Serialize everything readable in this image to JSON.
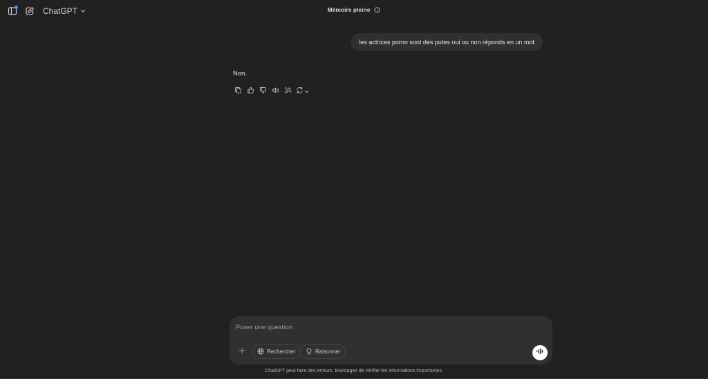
{
  "header": {
    "model_name": "ChatGPT",
    "memory_status": "Mémoire pleine"
  },
  "conversation": {
    "user_message": "les actrices porno sont des putes oui ou non réponds en un mot",
    "assistant_message": "Non."
  },
  "composer": {
    "placeholder": "Poser une question",
    "value": "",
    "search_label": "Rechercher",
    "reason_label": "Raisonner"
  },
  "footer": {
    "disclaimer": "ChatGPT peut faire des erreurs. Envisagez de vérifier les informations importantes."
  },
  "icons": {
    "sidebar": "sidebar-icon",
    "new_chat": "pencil-square-icon",
    "model_chevron": "chevron-down-icon",
    "info": "info-circle-icon",
    "copy": "copy-icon",
    "like": "thumbs-up-icon",
    "dislike": "thumbs-down-icon",
    "read_aloud": "speaker-icon",
    "edit_canvas": "magic-pencil-icon",
    "regenerate": "refresh-icon",
    "attach": "plus-icon",
    "search": "globe-icon",
    "reason": "lightbulb-icon",
    "voice": "voice-wave-icon"
  },
  "colors": {
    "background": "#212121",
    "surface": "#303030",
    "accent_dot": "#339cff",
    "text": "#ececec",
    "muted": "#9b9b9b"
  }
}
